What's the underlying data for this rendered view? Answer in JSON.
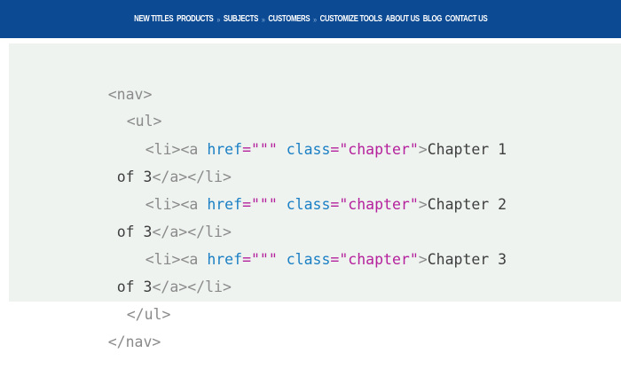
{
  "header": {
    "nav_items": [
      "NEW TITLES",
      "PRODUCTS",
      "SUBJECTS",
      "CUSTOMERS",
      "CUSTOMIZE TOOLS",
      "ABOUT US",
      "BLOG",
      "CONTACT US"
    ],
    "separator": "»",
    "background_color": "#0c4a93"
  },
  "code": {
    "nav_open": "<nav>",
    "ul_open": "<ul>",
    "li_open": "<li>",
    "a_open_start": "<a",
    "href_attr": "href",
    "href_value": "=\"\"\"",
    "class_attr": "class",
    "class_value": "=\"chapter\"",
    "a_open_end": ">",
    "items": [
      {
        "text_line1": "Chapter 1",
        "text_line2": "of 3"
      },
      {
        "text_line1": "Chapter 2",
        "text_line2": "of 3"
      },
      {
        "text_line1": "Chapter 3",
        "text_line2": "of 3"
      }
    ],
    "a_close": "</a>",
    "li_close": "</li>",
    "ul_close": "</ul>",
    "nav_close": "</nav>",
    "colors": {
      "tag": "#8a8a8a",
      "attribute": "#1a7fc4",
      "string": "#b5219c",
      "text": "#3e3e3e",
      "background": "#eef3f0"
    }
  }
}
